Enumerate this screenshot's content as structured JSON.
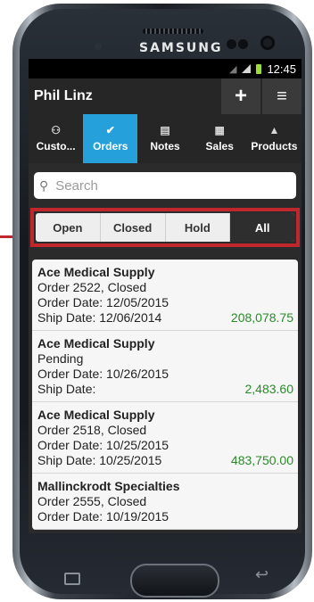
{
  "device": {
    "brand": "SAMSUNG"
  },
  "status_bar": {
    "time": "12:45"
  },
  "app_bar": {
    "title": "Phil Linz",
    "add_icon": "+",
    "menu_icon": "≡"
  },
  "nav_tabs": [
    {
      "label": "Custo...",
      "icon": "customers-icon"
    },
    {
      "label": "Orders",
      "icon": "check-icon",
      "active": true
    },
    {
      "label": "Notes",
      "icon": "notes-icon"
    },
    {
      "label": "Sales",
      "icon": "sales-icon"
    },
    {
      "label": "Products",
      "icon": "products-icon"
    }
  ],
  "search": {
    "placeholder": "Search"
  },
  "filters": [
    {
      "label": "Open"
    },
    {
      "label": "Closed"
    },
    {
      "label": "Hold"
    },
    {
      "label": "All",
      "active": true
    }
  ],
  "orders": [
    {
      "name": "Ace Medical Supply",
      "status": "Order 2522, Closed",
      "order_date": "Order Date: 12/05/2015",
      "ship_date": "Ship Date: 12/06/2014",
      "amount": "208,078.75"
    },
    {
      "name": "Ace Medical Supply",
      "status": "Pending",
      "order_date": "Order Date: 10/26/2015",
      "ship_date": "Ship Date:",
      "amount": "2,483.60"
    },
    {
      "name": "Ace Medical Supply",
      "status": "Order 2518, Closed",
      "order_date": "Order Date: 10/25/2015",
      "ship_date": "Ship Date: 10/25/2015",
      "amount": "483,750.00"
    },
    {
      "name": "Mallinckrodt Specialties",
      "status": "Order 2555, Closed",
      "order_date": "Order Date: 10/19/2015",
      "ship_date": "",
      "amount": ""
    }
  ],
  "colors": {
    "accent": "#26a0da",
    "highlight_frame": "#c0272d",
    "amount_green": "#2a8a2a"
  }
}
